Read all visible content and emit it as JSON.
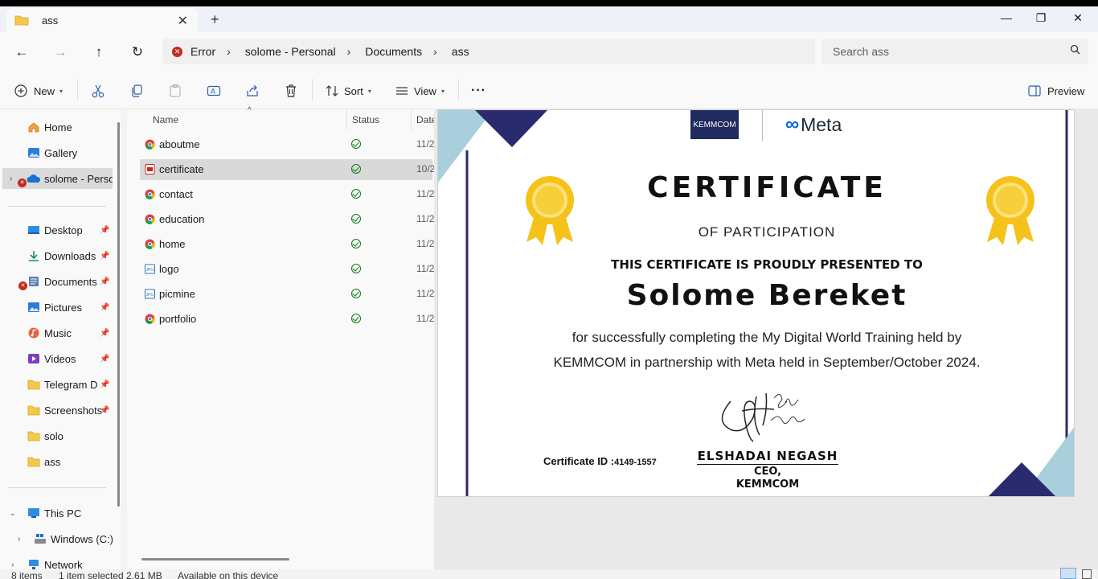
{
  "window": {
    "tab_title": "ass",
    "new_tab_glyph": "+",
    "close_tab_glyph": "✕",
    "minimize_glyph": "—",
    "restore_glyph": "❐",
    "close_glyph": "✕"
  },
  "nav": {
    "back_glyph": "←",
    "forward_glyph": "→",
    "up_glyph": "↑",
    "refresh_glyph": "↻",
    "breadcrumbs": [
      "Error",
      "solome - Personal",
      "Documents",
      "ass"
    ],
    "separator": "›",
    "search_placeholder": "Search ass"
  },
  "toolbar": {
    "new_label": "New",
    "sort_label": "Sort",
    "view_label": "View",
    "more_glyph": "···",
    "preview_label": "Preview",
    "icons": [
      "add-icon",
      "cut-icon",
      "copy-icon",
      "paste-icon",
      "rename-icon",
      "share-icon",
      "delete-icon",
      "sort-icon",
      "view-icon"
    ]
  },
  "sidebar": {
    "quick": [
      {
        "label": "Home",
        "icon": "home-icon"
      },
      {
        "label": "Gallery",
        "icon": "gallery-icon"
      },
      {
        "label": "solome - Personal",
        "icon": "onedrive-icon"
      }
    ],
    "pinned": [
      {
        "label": "Desktop",
        "icon": "desktop-icon"
      },
      {
        "label": "Downloads",
        "icon": "downloads-icon"
      },
      {
        "label": "Documents",
        "icon": "documents-icon"
      },
      {
        "label": "Pictures",
        "icon": "pictures-icon"
      },
      {
        "label": "Music",
        "icon": "music-icon"
      },
      {
        "label": "Videos",
        "icon": "videos-icon"
      },
      {
        "label": "Telegram Desktop",
        "icon": "folder-icon"
      },
      {
        "label": "Screenshots",
        "icon": "folder-icon"
      },
      {
        "label": "solo",
        "icon": "folder-icon"
      },
      {
        "label": "ass",
        "icon": "folder-icon"
      }
    ],
    "devices": [
      {
        "label": "This PC",
        "icon": "pc-icon"
      },
      {
        "label": "Windows (C:)",
        "icon": "drive-icon"
      },
      {
        "label": "Network",
        "icon": "network-icon"
      }
    ]
  },
  "files": {
    "columns": [
      "Name",
      "Status",
      "Date"
    ],
    "rows": [
      {
        "name": "aboutme",
        "type": "chrome-html",
        "date": "11/2"
      },
      {
        "name": "certificate",
        "type": "pdf",
        "date": "10/2"
      },
      {
        "name": "contact",
        "type": "chrome-html",
        "date": "11/2"
      },
      {
        "name": "education",
        "type": "chrome-html",
        "date": "11/2"
      },
      {
        "name": "home",
        "type": "chrome-html",
        "date": "11/2"
      },
      {
        "name": "logo",
        "type": "jpg",
        "date": "11/2"
      },
      {
        "name": "picmine",
        "type": "jpg",
        "date": "11/2"
      },
      {
        "name": "portfolio",
        "type": "chrome-html",
        "date": "11/2"
      }
    ]
  },
  "certificate": {
    "logo_left": "KEMMCOM",
    "logo_right": "Meta",
    "title": "CERTIFICATE",
    "subtitle": "OF PARTICIPATION",
    "presented": "THIS CERTIFICATE IS PROUDLY PRESENTED TO",
    "recipient": "Solome Bereket",
    "body_line1": "for successfully completing the My Digital World Training held by",
    "body_line2": "KEMMCOM in partnership with Meta held in September/October 2024.",
    "cert_id_label": "Certificate ID :",
    "cert_id_value": "4149-1557",
    "signer_name": "ELSHADAI NEGASH",
    "signer_role": "CEO,",
    "signer_org": "KEMMCOM",
    "signature_text": "Elshadai Negash"
  },
  "statusbar": {
    "count": "8 items",
    "selected": "1 item selected  2.61 MB",
    "availability": "Available on this device"
  },
  "colors": {
    "accent": "#0067c0",
    "folder_yellow": "#f2c94c",
    "error_red": "#c42b1c",
    "status_green": "#0f7b0f",
    "cert_navy": "#2b2a6e",
    "cert_lightblue": "#a9cfdc",
    "medal_gold": "#f4c21b"
  }
}
